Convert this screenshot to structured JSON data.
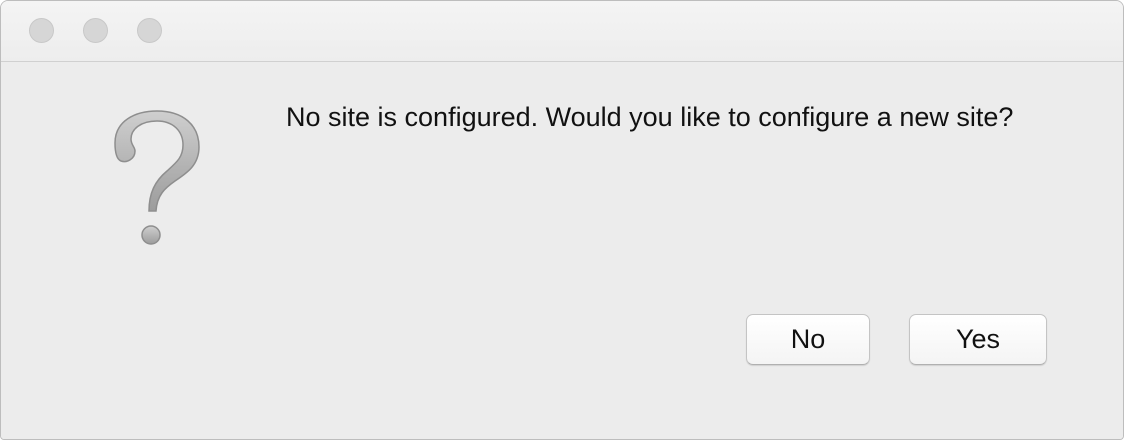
{
  "window": {
    "controls": [
      {
        "name": "close",
        "icon": "close-icon"
      },
      {
        "name": "minimize",
        "icon": "minimize-icon"
      },
      {
        "name": "zoom",
        "icon": "zoom-icon"
      }
    ]
  },
  "dialog": {
    "icon": "question-mark-icon",
    "message": "No site is configured. Would you like to configure a new site?",
    "buttons": {
      "no_label": "No",
      "yes_label": "Yes"
    }
  },
  "colors": {
    "window_background": "#ececec",
    "titlebar_background": "#f0f0f0",
    "traffic_light_inactive": "#d6d6d6",
    "icon_gray": "#a8a8a8",
    "text": "#111111"
  }
}
